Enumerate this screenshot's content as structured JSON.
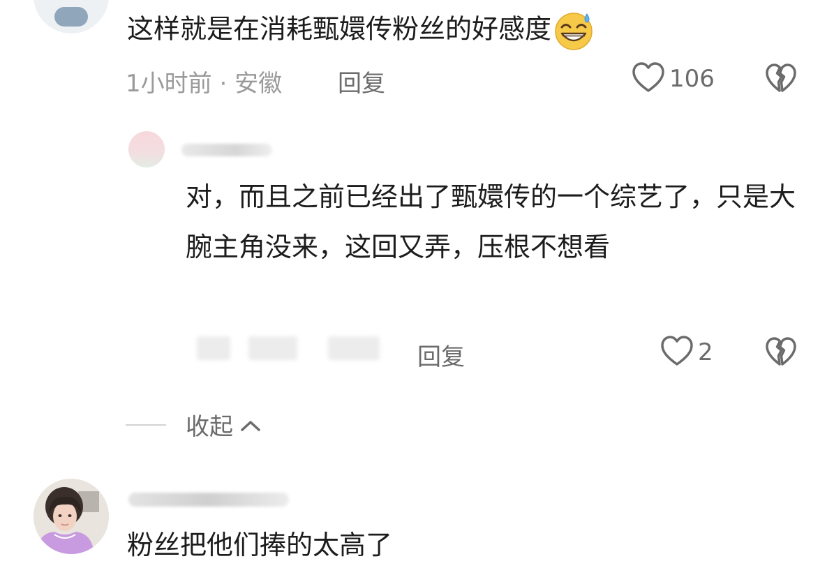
{
  "comment1": {
    "text": "这样就是在消耗甄嬛传粉丝的好感度",
    "emoji_icon": "grinning-sweat-emoji",
    "time": "1小时前",
    "separator": "·",
    "location": "安徽",
    "reply_label": "回复",
    "like_count": "106"
  },
  "reply1": {
    "text": "对，而且之前已经出了甄嬛传的一个综艺了，只是大腕主角没来，这回又弄，压根不想看",
    "reply_label": "回复",
    "like_count": "2"
  },
  "collapse": {
    "label": "收起"
  },
  "comment2": {
    "text": "粉丝把他们捧的太高了"
  },
  "icons": {
    "like": "heart-outline-icon",
    "dislike": "broken-heart-icon",
    "collapse": "chevron-up-icon"
  },
  "colors": {
    "text": "#1c1c1c",
    "meta": "#9a9a9a",
    "action": "#6b6b6b"
  }
}
